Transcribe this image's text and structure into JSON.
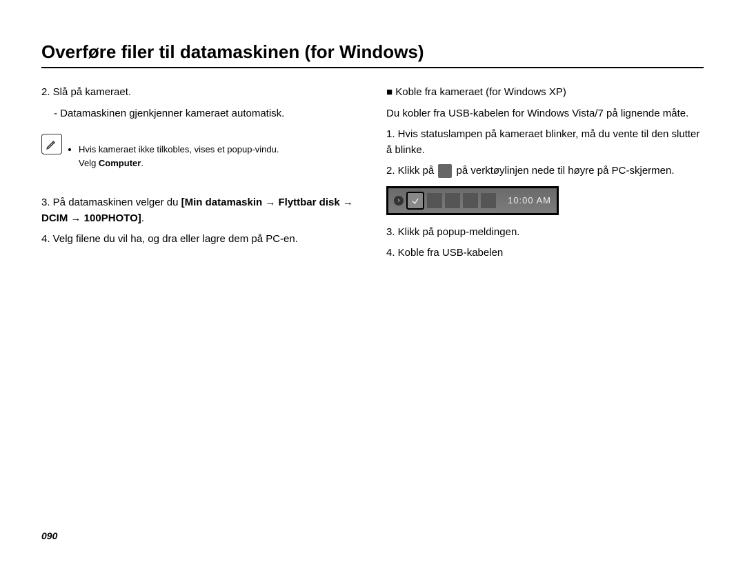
{
  "title": "Overføre filer til datamaskinen (for Windows)",
  "left": {
    "step2": "2. Slå på kameraet.",
    "step2_sub": "- Datamaskinen gjenkjenner kameraet automatisk.",
    "note_line1": "Hvis kameraet ikke tilkobles, vises et popup-vindu.",
    "note_line2_pre": "Velg ",
    "note_line2_bold": "Computer",
    "note_line2_post": ".",
    "step3_pre": "3. På datamaskinen velger du ",
    "step3_bold": "[Min datamaskin → Flyttbar disk → DCIM → 100PHOTO]",
    "step3_post": ".",
    "step4": "4. Velg filene du vil ha, og dra eller lagre dem på PC-en."
  },
  "right": {
    "heading": "Koble fra kameraet (for Windows XP)",
    "intro": "Du kobler fra USB-kabelen for Windows Vista/7 på lignende måte.",
    "step1": "1. Hvis statuslampen på kameraet blinker, må du vente til den slutter å blinke.",
    "step2_pre": "2. Klikk på ",
    "step2_post": " på verktøylinjen nede til høyre på PC-skjermen.",
    "taskbar_time": "10:00 AM",
    "step3": "3. Klikk på popup-meldingen.",
    "step4": "4. Koble fra USB-kabelen"
  },
  "page_number": "090"
}
